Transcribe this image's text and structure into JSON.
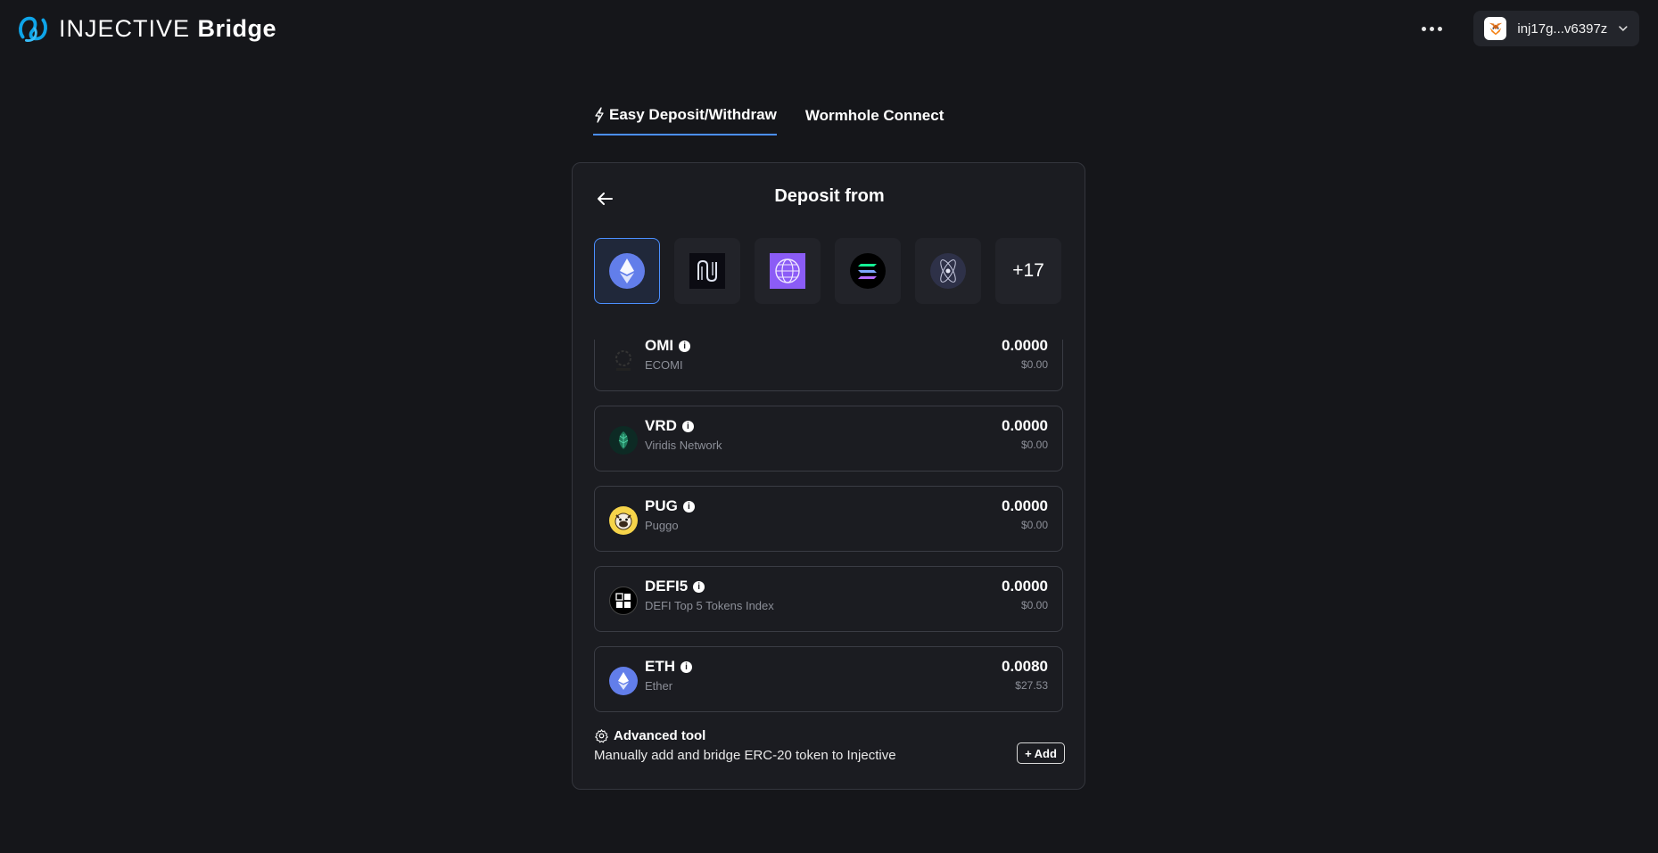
{
  "header": {
    "brand_main": "INJECTIVE",
    "brand_sub": "Bridge",
    "wallet_address": "inj17g...v6397z"
  },
  "tabs": [
    {
      "label": "Easy Deposit/Withdraw",
      "active": true
    },
    {
      "label": "Wormhole Connect",
      "active": false
    }
  ],
  "card": {
    "title": "Deposit from",
    "chains": [
      {
        "icon": "ethereum-icon",
        "selected": true
      },
      {
        "icon": "axelar-icon",
        "selected": false
      },
      {
        "icon": "globe-network-icon",
        "selected": false
      },
      {
        "icon": "solana-icon",
        "selected": false
      },
      {
        "icon": "cosmos-icon",
        "selected": false
      }
    ],
    "more_chains_label": "+17",
    "tokens": [
      {
        "symbol": "OMI",
        "name": "ECOMI",
        "balance": "0.0000",
        "usd": "$0.00",
        "icon": "ecomi-icon"
      },
      {
        "symbol": "VRD",
        "name": "Viridis Network",
        "balance": "0.0000",
        "usd": "$0.00",
        "icon": "viridis-icon"
      },
      {
        "symbol": "PUG",
        "name": "Puggo",
        "balance": "0.0000",
        "usd": "$0.00",
        "icon": "puggo-icon"
      },
      {
        "symbol": "DEFI5",
        "name": "DEFI Top 5 Tokens Index",
        "balance": "0.0000",
        "usd": "$0.00",
        "icon": "defi5-icon"
      },
      {
        "symbol": "ETH",
        "name": "Ether",
        "balance": "0.0080",
        "usd": "$27.53",
        "icon": "ethereum-icon"
      }
    ],
    "advanced": {
      "title": "Advanced tool",
      "description": "Manually add and bridge ERC-20 token to Injective",
      "add_label": "Add"
    }
  },
  "colors": {
    "background": "#15161a",
    "card": "#1b1c21",
    "accent": "#4b8fff",
    "muted_text": "#8c8f98"
  }
}
